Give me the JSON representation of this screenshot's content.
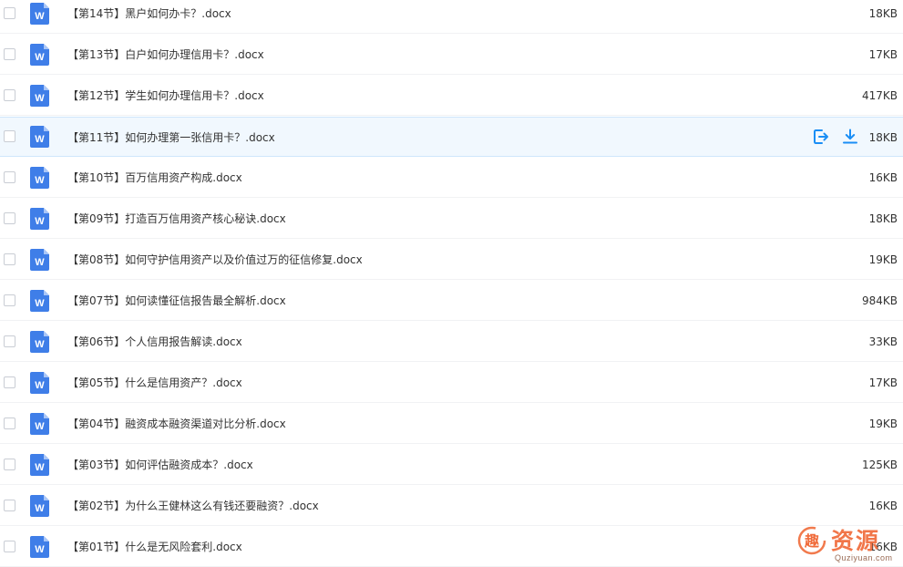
{
  "files": [
    {
      "name": "【第14节】黑户如何办卡？.docx",
      "size": "18KB"
    },
    {
      "name": "【第13节】白户如何办理信用卡？.docx",
      "size": "17KB"
    },
    {
      "name": "【第12节】学生如何办理信用卡？.docx",
      "size": "417KB"
    },
    {
      "name": "【第11节】如何办理第一张信用卡？.docx",
      "size": "18KB"
    },
    {
      "name": "【第10节】百万信用资产构成.docx",
      "size": "16KB"
    },
    {
      "name": "【第09节】打造百万信用资产核心秘诀.docx",
      "size": "18KB"
    },
    {
      "name": "【第08节】如何守护信用资产以及价值过万的征信修复.docx",
      "size": "19KB"
    },
    {
      "name": "【第07节】如何读懂征信报告最全解析.docx",
      "size": "984KB"
    },
    {
      "name": "【第06节】个人信用报告解读.docx",
      "size": "33KB"
    },
    {
      "name": "【第05节】什么是信用资产？.docx",
      "size": "17KB"
    },
    {
      "name": "【第04节】融资成本融资渠道对比分析.docx",
      "size": "19KB"
    },
    {
      "name": "【第03节】如何评估融资成本？.docx",
      "size": "125KB"
    },
    {
      "name": "【第02节】为什么王健林这么有钱还要融资？.docx",
      "size": "16KB"
    },
    {
      "name": "【第01节】什么是无风险套利.docx",
      "size": "16KB"
    }
  ],
  "file_icon_letter": "W",
  "hovered_index": 3,
  "icons": {
    "file_type": "word-doc-icon",
    "share": "share-icon",
    "download": "download-icon"
  },
  "watermark": {
    "title": "资源",
    "subtitle": "Quziyuan.com",
    "logo_glyph": "趣"
  },
  "colors": {
    "accent": "#1a8ef5",
    "word_blue": "#3f7ee8",
    "hover_bg": "#f1f8fe",
    "watermark": "#f06b3a"
  }
}
